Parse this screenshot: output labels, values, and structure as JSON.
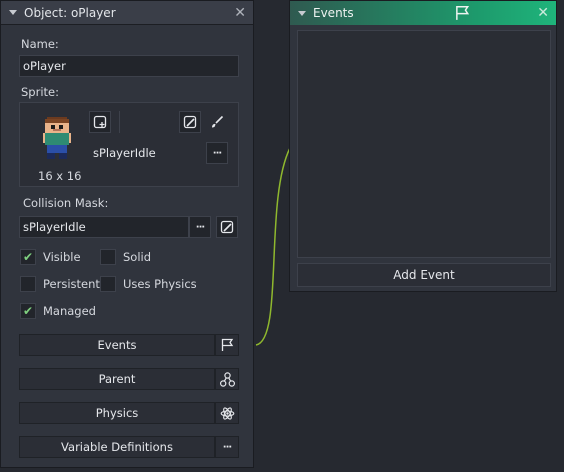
{
  "object_panel": {
    "title": "Object: oPlayer",
    "name_label": "Name:",
    "name_value": "oPlayer",
    "sprite_label": "Sprite:",
    "sprite_name": "sPlayerIdle",
    "sprite_size": "16 x 16",
    "collision_mask_label": "Collision Mask:",
    "collision_mask_value": "sPlayerIdle",
    "checkboxes": {
      "visible": {
        "label": "Visible",
        "checked": true
      },
      "solid": {
        "label": "Solid",
        "checked": false
      },
      "persistent": {
        "label": "Persistent",
        "checked": false
      },
      "uses_physics": {
        "label": "Uses Physics",
        "checked": false
      },
      "managed": {
        "label": "Managed",
        "checked": true
      }
    },
    "buttons": {
      "events": "Events",
      "parent": "Parent",
      "physics": "Physics",
      "variable_definitions": "Variable Definitions"
    },
    "more_glyph": "···"
  },
  "events_panel": {
    "title": "Events",
    "add_event_label": "Add Event"
  },
  "colors": {
    "events_header_accent": "#1fb47b",
    "connector": "#8fb82e",
    "checkmark": "#7fd07f"
  }
}
